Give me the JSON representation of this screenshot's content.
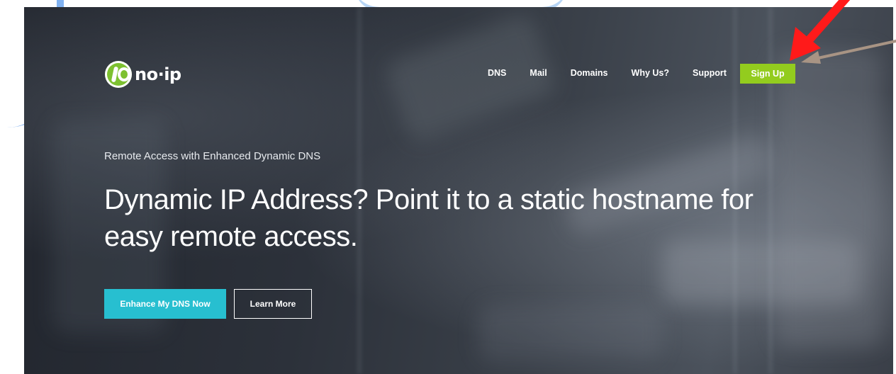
{
  "brand": {
    "logo_text": "no·ip",
    "accent_green": "#93cc1e",
    "accent_cyan": "#27bfd0"
  },
  "nav": {
    "items": [
      {
        "label": "DNS"
      },
      {
        "label": "Mail"
      },
      {
        "label": "Domains"
      },
      {
        "label": "Why Us?"
      },
      {
        "label": "Support"
      }
    ],
    "signup_label": "Sign Up"
  },
  "hero": {
    "eyebrow": "Remote Access with Enhanced Dynamic DNS",
    "headline": "Dynamic IP Address? Point it to a static hostname for easy remote access.",
    "primary_cta": "Enhance My DNS Now",
    "secondary_cta": "Learn More"
  },
  "annotations": {
    "arrow_color_primary": "#ff1a1a",
    "arrow_color_secondary": "#a89484"
  }
}
